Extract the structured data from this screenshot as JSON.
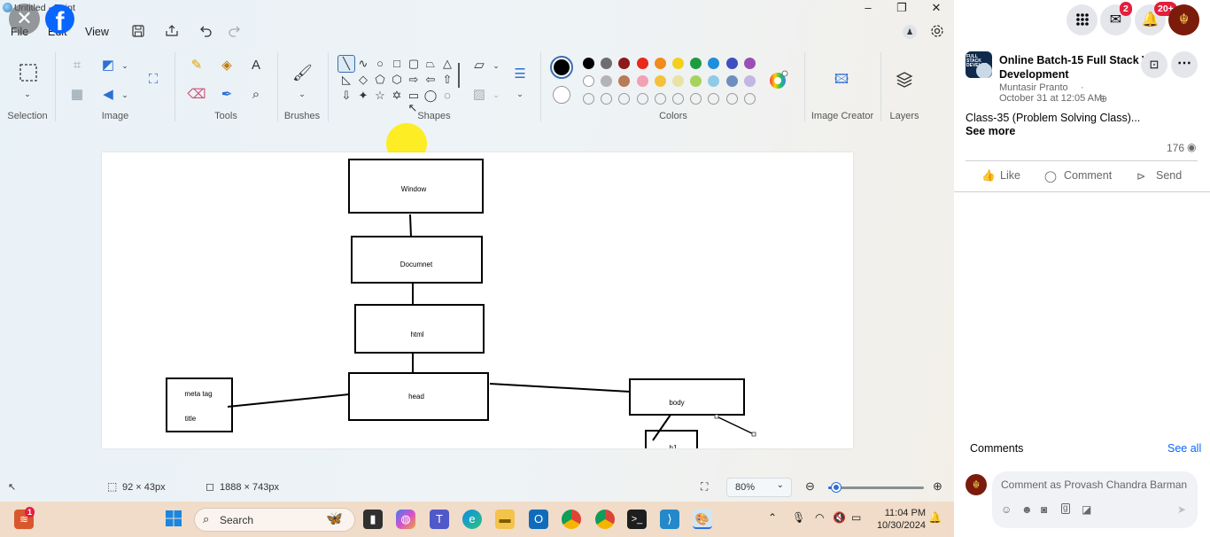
{
  "window": {
    "title": "Untitled - Paint",
    "close_overlay": "✕",
    "fb_logo": "f"
  },
  "menu": {
    "file": "File",
    "edit": "Edit",
    "view": "View"
  },
  "ribbon": {
    "groups": {
      "selection": "Selection",
      "image": "Image",
      "tools": "Tools",
      "brushes": "Brushes",
      "shapes": "Shapes",
      "colors": "Colors",
      "image_creator": "Image Creator",
      "layers": "Layers"
    },
    "palette_row1": [
      "#000000",
      "#6e6e6e",
      "#8b1a1a",
      "#e8291c",
      "#f08c1c",
      "#f4d01d",
      "#1e9b3f",
      "#1f8fdc",
      "#3e4fc2",
      "#9b4fb4"
    ],
    "palette_row2": [
      "#ffffff",
      "#b4b4b4",
      "#b97a57",
      "#f2a0b4",
      "#f5c13c",
      "#e9e2a4",
      "#a6d35b",
      "#8fcbe6",
      "#6c8fbf",
      "#c2b6e2"
    ]
  },
  "canvas": {
    "boxes": {
      "window": "Window",
      "document": "Documnet",
      "html": "html",
      "head": "head",
      "body": "body",
      "meta": "meta tag",
      "title": "title",
      "h1": "h1"
    }
  },
  "statusbar": {
    "selection_size": "92 × 43px",
    "canvas_size": "1888 × 743px",
    "zoom": "80%",
    "zoom_level": 0.08
  },
  "taskbar": {
    "search_placeholder": "Search",
    "notification_count": "1",
    "time": "11:04 PM",
    "date": "10/30/2024"
  },
  "facebook": {
    "messenger_badge": "2",
    "notif_badge": "20+",
    "post": {
      "title": "Online Batch-15 Full Stack Web Development",
      "author": "Muntasir Pranto",
      "time": "October 31 at 12:05 AM",
      "text": "Class-35 (Problem Solving Class)...",
      "see_more": "See more",
      "views": "176",
      "thumb_text": "FULL STACK DEVELOP"
    },
    "actions": {
      "like": "Like",
      "comment": "Comment",
      "send": "Send"
    },
    "comments_label": "Comments",
    "see_all": "See all",
    "comment_placeholder": "Comment as Provash Chandra Barman"
  }
}
